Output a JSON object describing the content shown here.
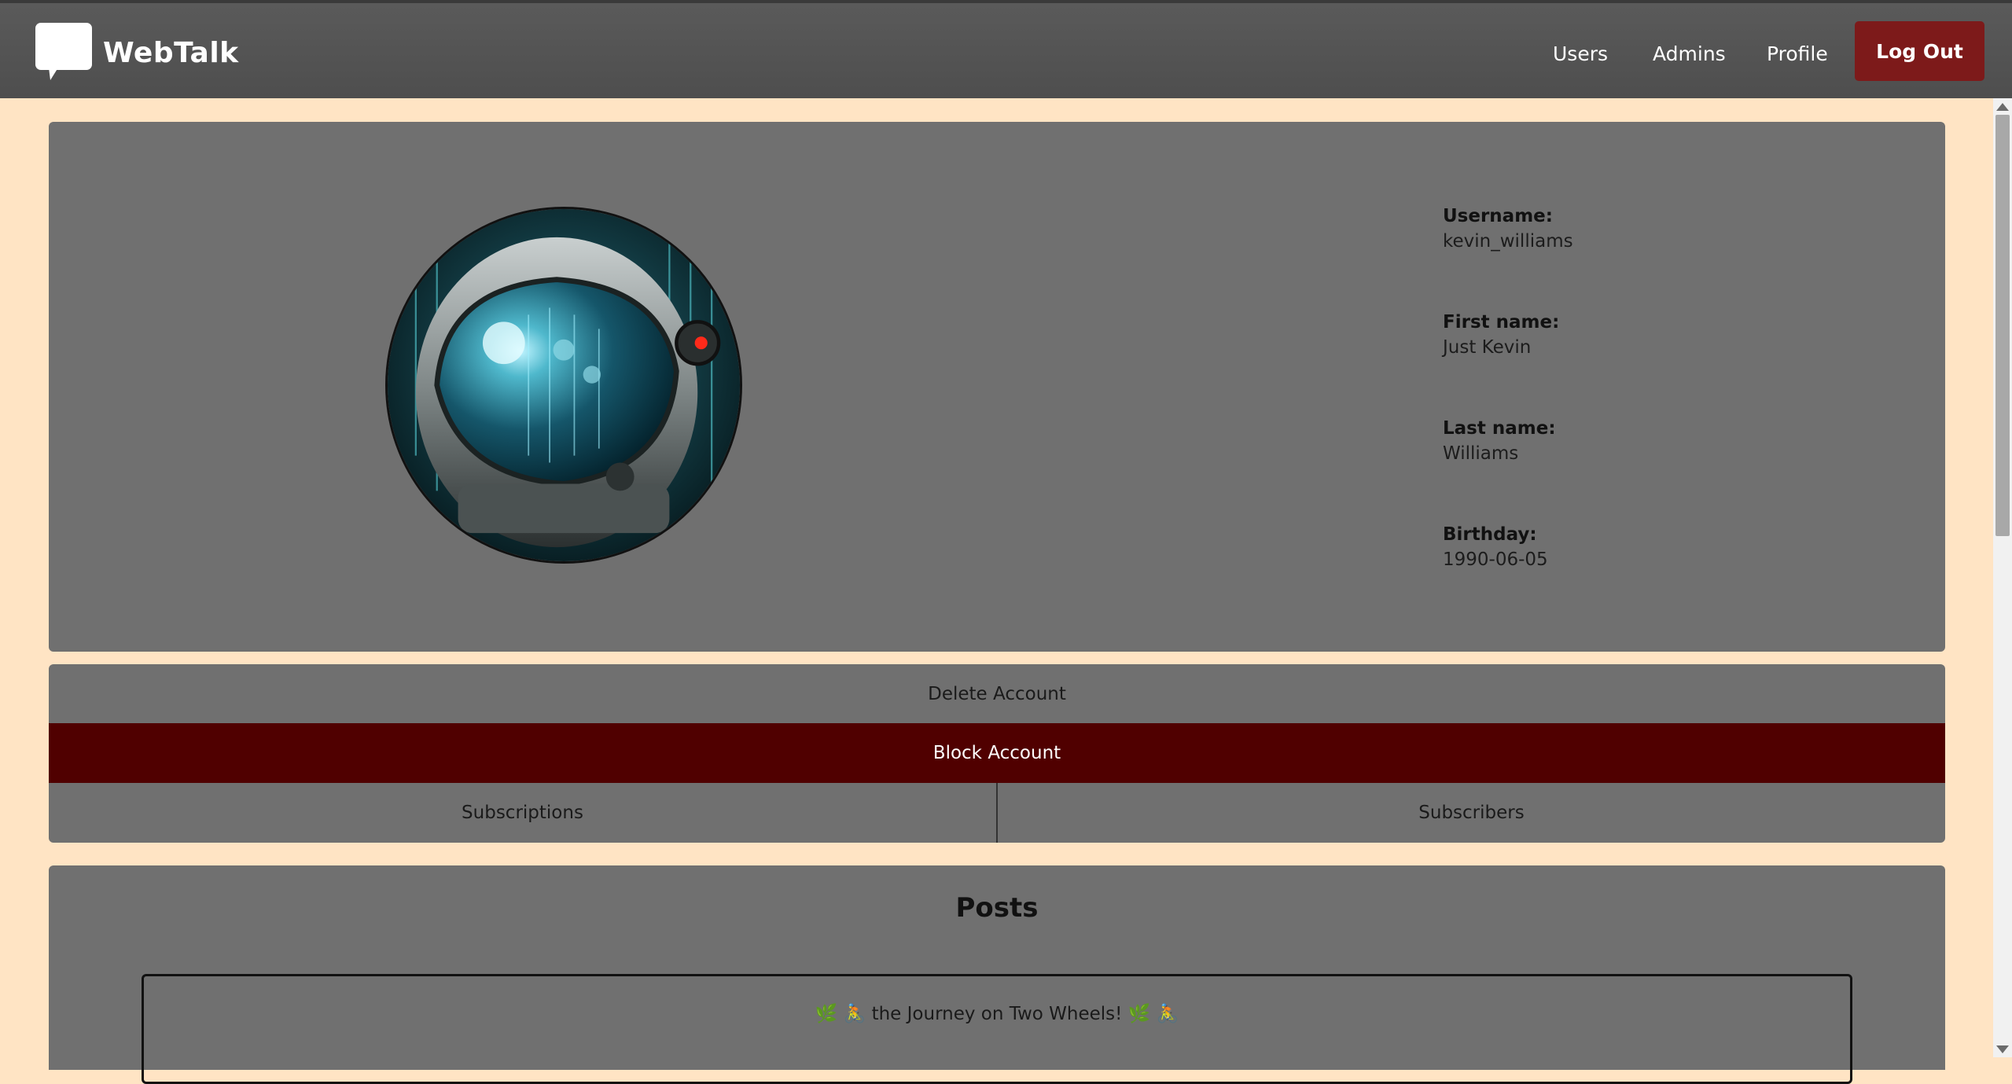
{
  "app": {
    "name": "WebTalk",
    "icon": "chat-bubble-icon"
  },
  "nav": {
    "users": "Users",
    "admins": "Admins",
    "profile": "Profile",
    "logout": "Log Out"
  },
  "profile": {
    "avatar_alt": "astronaut-helmet-avatar",
    "fields": [
      {
        "label": "Username:",
        "value": "kevin_williams"
      },
      {
        "label": "First name:",
        "value": "Just Kevin"
      },
      {
        "label": "Last name:",
        "value": "Williams"
      },
      {
        "label": "Birthday:",
        "value": "1990-06-05"
      }
    ]
  },
  "actions": {
    "delete": "Delete Account",
    "block": "Block Account",
    "subscriptions": "Subscriptions",
    "subscribers": "Subscribers"
  },
  "posts": {
    "heading": "Posts",
    "items": [
      {
        "title": "🌿 🚴 the Journey on Two Wheels! 🌿 🚴"
      }
    ]
  },
  "colors": {
    "background": "#ffe4c4",
    "navbar": "#525252",
    "card": "#707070",
    "logout": "#7d1a1a",
    "block": "#500000"
  }
}
